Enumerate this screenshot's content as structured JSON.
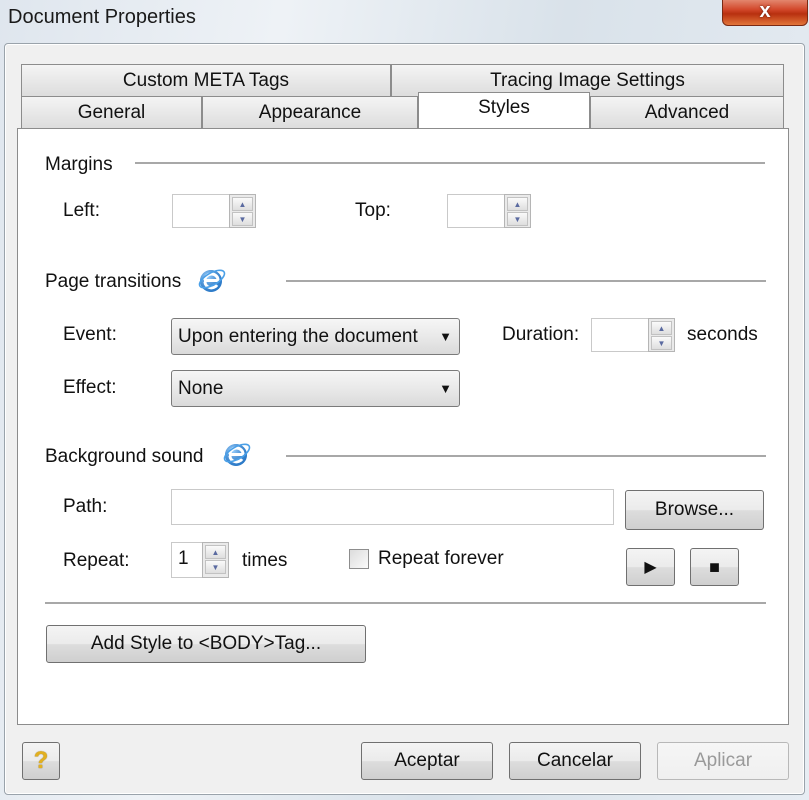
{
  "window": {
    "title": "Document Properties",
    "close_label": "x"
  },
  "tabs": {
    "row1": [
      {
        "label": "Custom META Tags"
      },
      {
        "label": "Tracing Image Settings"
      }
    ],
    "row2": [
      {
        "label": "General"
      },
      {
        "label": "Appearance"
      },
      {
        "label": "Styles",
        "active": true
      },
      {
        "label": "Advanced"
      }
    ]
  },
  "margins": {
    "section_label": "Margins",
    "left_label": "Left:",
    "left_value": "",
    "top_label": "Top:",
    "top_value": ""
  },
  "page_transitions": {
    "section_label": "Page transitions",
    "icon": "internet-explorer-icon",
    "event_label": "Event:",
    "event_value": "Upon entering the document",
    "duration_label": "Duration:",
    "duration_value": "",
    "duration_unit": "seconds",
    "effect_label": "Effect:",
    "effect_value": "None"
  },
  "background_sound": {
    "section_label": "Background sound",
    "icon": "internet-explorer-icon",
    "path_label": "Path:",
    "path_value": "",
    "browse_label": "Browse...",
    "repeat_label": "Repeat:",
    "repeat_value": "1",
    "repeat_unit": "times",
    "repeat_forever_label": "Repeat forever",
    "repeat_forever_checked": false,
    "play_icon": "play-icon",
    "stop_icon": "stop-icon"
  },
  "add_style_label": "Add Style to <BODY>Tag...",
  "footer": {
    "help_icon": "help-icon",
    "help_glyph": "?",
    "accept_label": "Aceptar",
    "cancel_label": "Cancelar",
    "apply_label": "Aplicar",
    "apply_disabled": true
  },
  "glyphs": {
    "spin_up": "▲",
    "spin_down": "▼",
    "dropdown": "▼",
    "play": "▶",
    "stop": "■"
  }
}
